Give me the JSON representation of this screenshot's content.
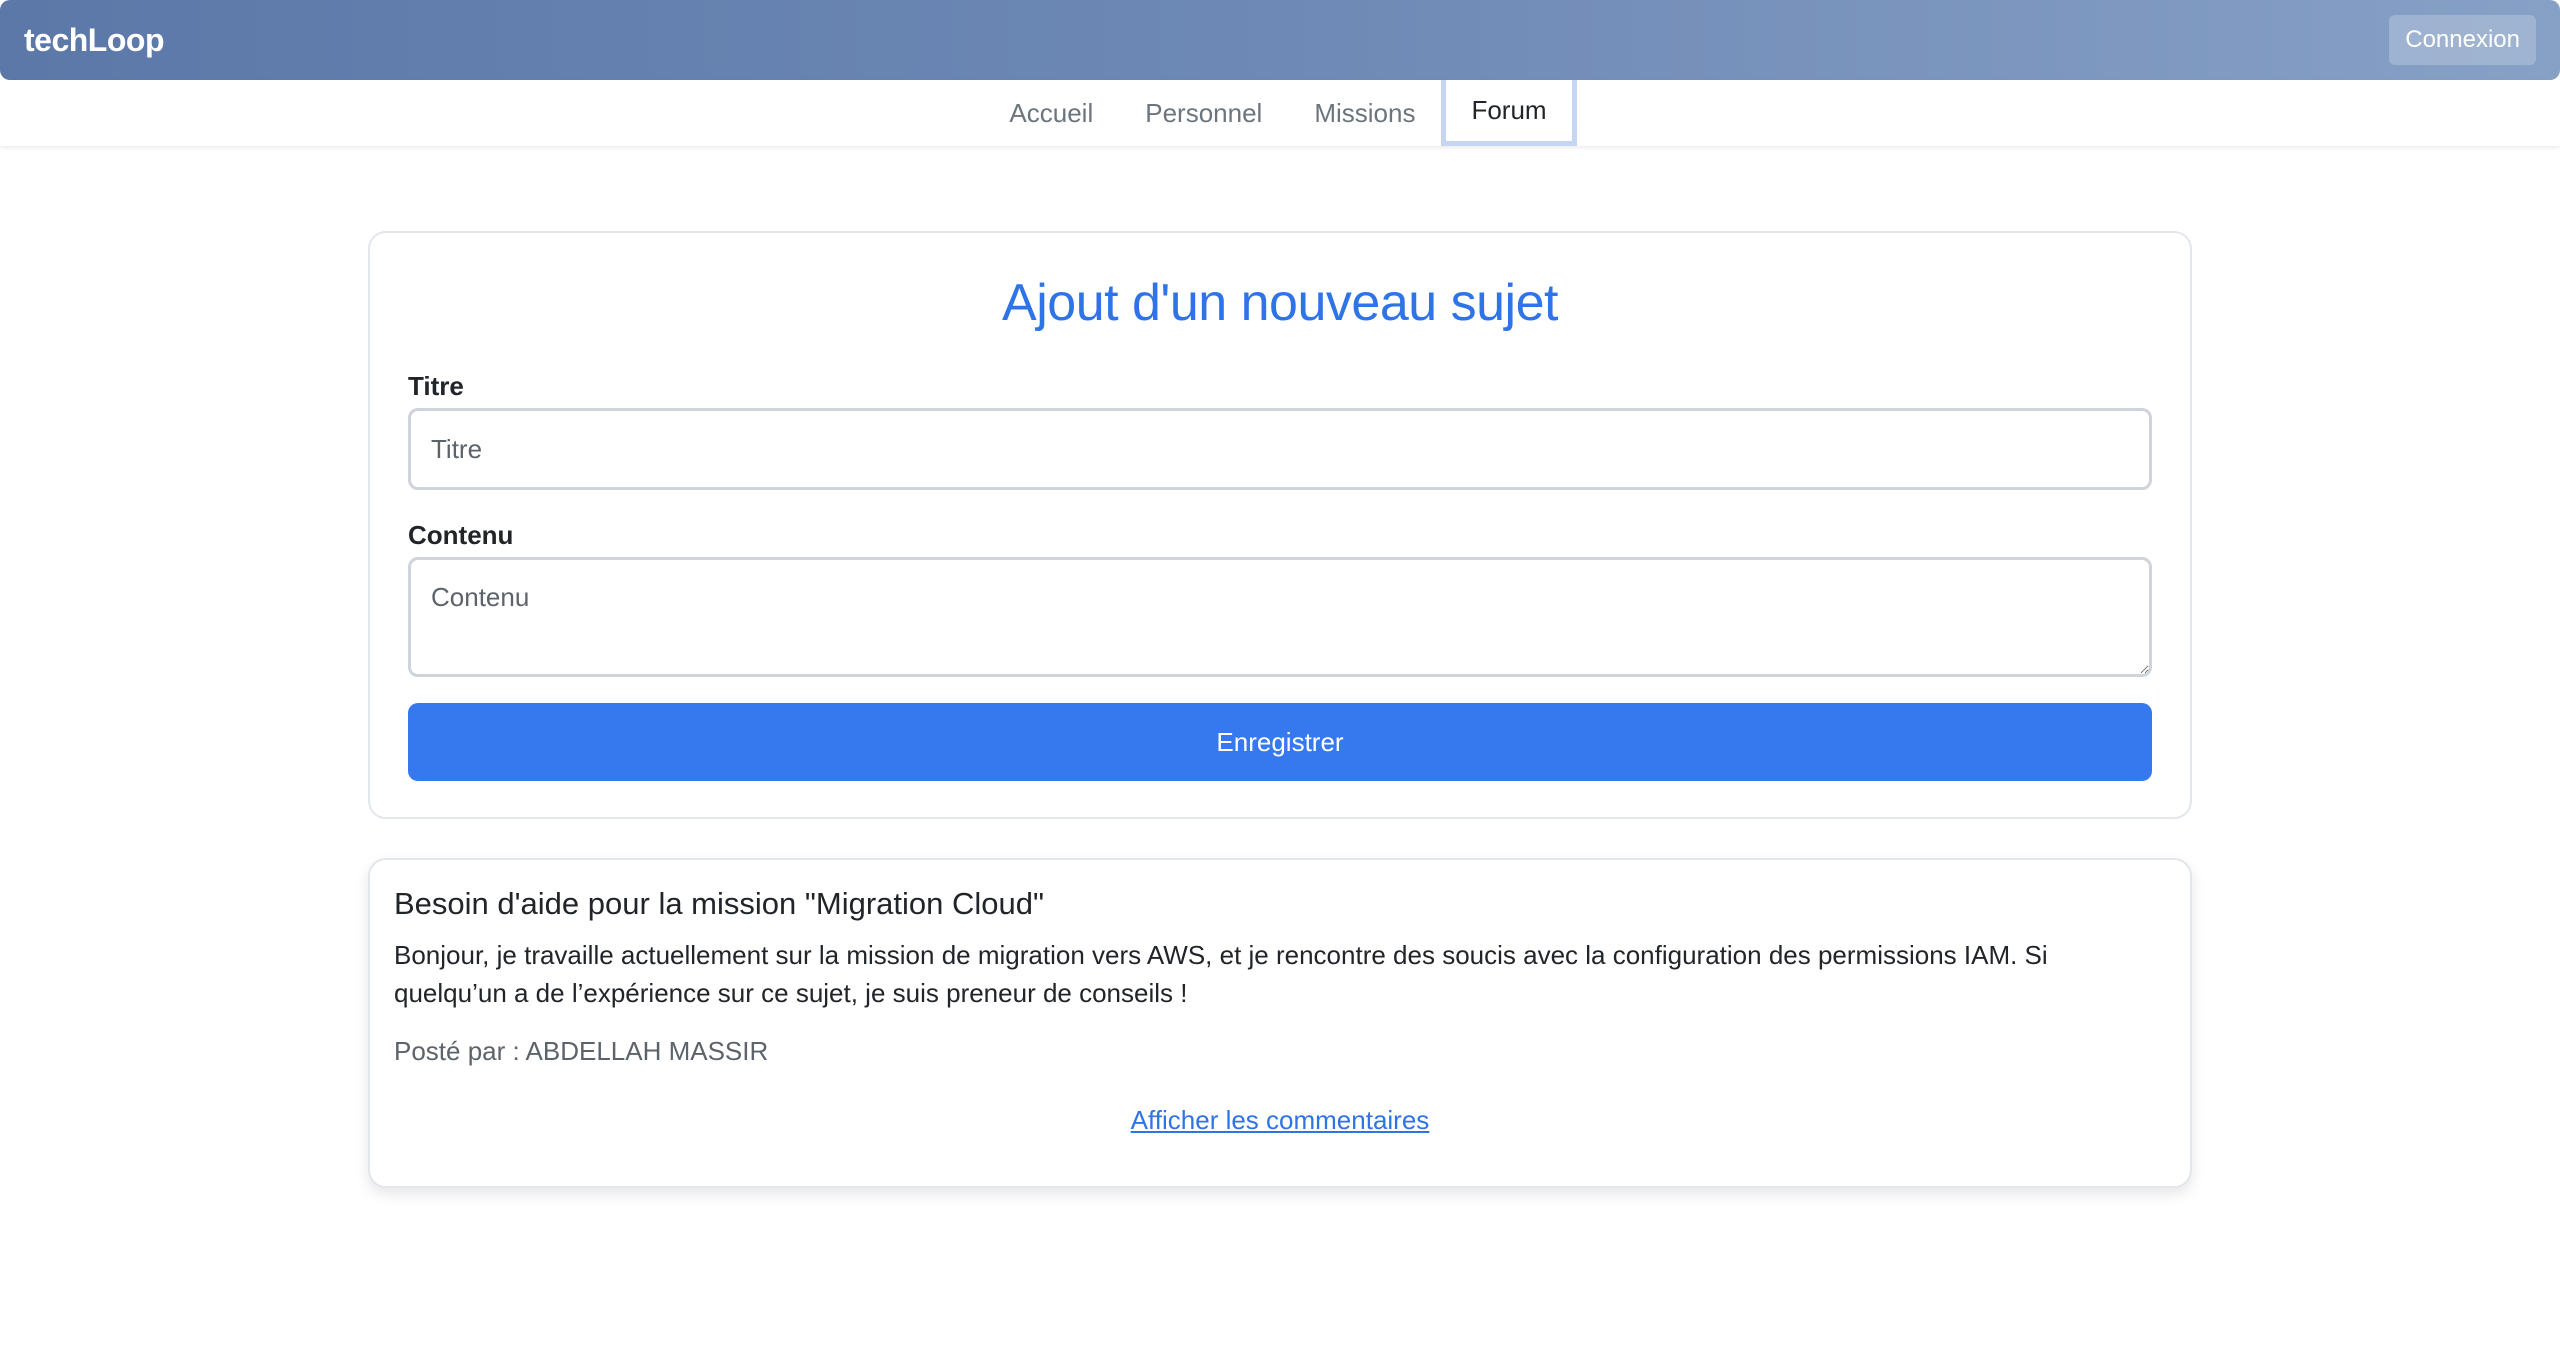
{
  "header": {
    "brand": "techLoop",
    "login_label": "Connexion"
  },
  "nav": {
    "items": [
      {
        "label": "Accueil"
      },
      {
        "label": "Personnel"
      },
      {
        "label": "Missions"
      },
      {
        "label": "Forum",
        "active": true
      }
    ]
  },
  "form": {
    "heading": "Ajout d'un nouveau sujet",
    "title_label": "Titre",
    "title_placeholder": "Titre",
    "title_value": "",
    "content_label": "Contenu",
    "content_placeholder": "Contenu",
    "content_value": "",
    "submit_label": "Enregistrer"
  },
  "posts": [
    {
      "title": "Besoin d'aide pour la mission \"Migration Cloud\"",
      "body": "Bonjour, je travaille actuellement sur la mission de migration vers AWS, et je rencontre des soucis avec la configuration des permissions IAM. Si quelqu’un a de l’expérience sur ce sujet, je suis preneur de conseils !",
      "author_line": "Posté par : ABDELLAH MASSIR",
      "comments_link": "Afficher les commentaires"
    }
  ],
  "colors": {
    "accent": "#2f74e6",
    "primary_button": "#3678ee",
    "header_gradient_start": "#5b78a8",
    "header_gradient_end": "#86a0c6"
  }
}
